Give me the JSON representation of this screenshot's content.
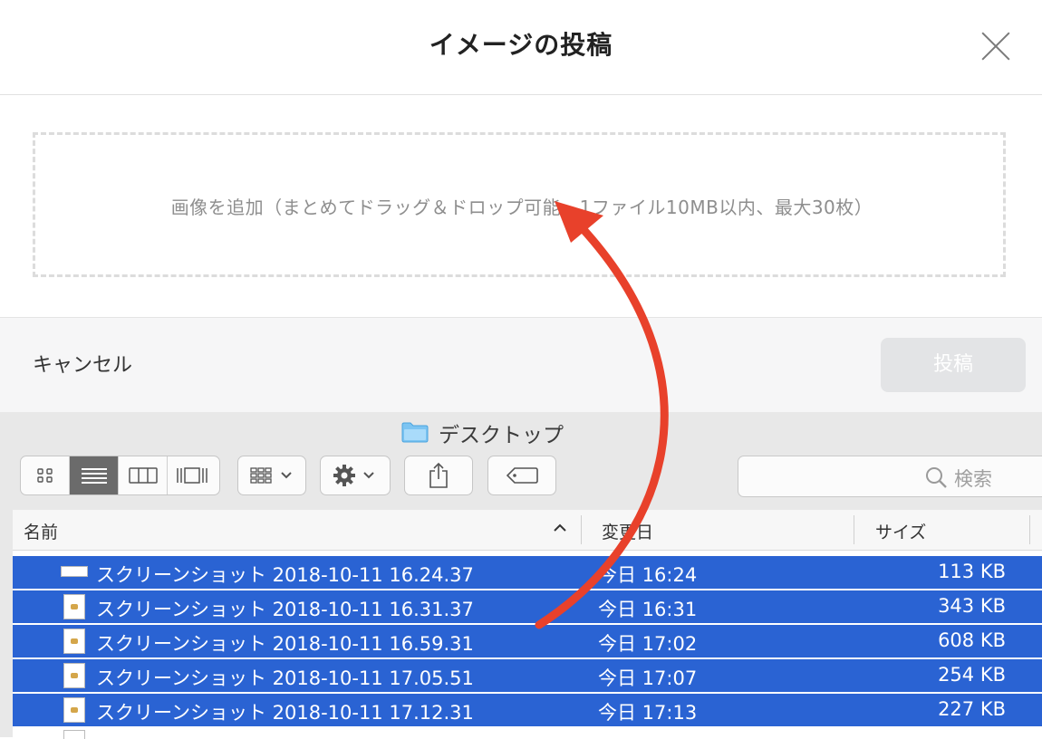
{
  "dialog": {
    "title": "イメージの投稿",
    "close_icon": "close-icon",
    "drop_zone_text": "画像を追加（まとめてドラッグ＆ドロップ可能、1ファイル10MB以内、最大30枚）",
    "cancel_label": "キャンセル",
    "post_label": "投稿"
  },
  "finder": {
    "window_title": "デスクトップ",
    "title_icon": "folder-icon",
    "toolbar": {
      "view_modes": [
        "icon-view-icon",
        "list-view-icon",
        "column-view-icon",
        "gallery-view-icon"
      ],
      "active_view": "list-view-icon",
      "arrange_icon": "arrange-icon",
      "action_icon": "gear-icon",
      "share_icon": "share-icon",
      "tag_icon": "tag-icon"
    },
    "search": {
      "placeholder": "検索",
      "icon": "search-icon"
    },
    "columns": {
      "name": "名前",
      "date": "変更日",
      "size": "サイズ"
    },
    "files": [
      {
        "name": "スクリーンショット 2018-10-11 16.24.37",
        "date": "今日 16:24",
        "size": "113 KB"
      },
      {
        "name": "スクリーンショット 2018-10-11 16.31.37",
        "date": "今日 16:31",
        "size": "343 KB"
      },
      {
        "name": "スクリーンショット 2018-10-11 16.59.31",
        "date": "今日 17:02",
        "size": "608 KB"
      },
      {
        "name": "スクリーンショット 2018-10-11 17.05.51",
        "date": "今日 17:07",
        "size": "254 KB"
      },
      {
        "name": "スクリーンショット 2018-10-11 17.12.31",
        "date": "今日 17:13",
        "size": "227 KB"
      }
    ]
  },
  "colors": {
    "selection": "#2a63d3",
    "arrow": "#e8412b",
    "post_button_disabled": "#e3e4e6"
  }
}
